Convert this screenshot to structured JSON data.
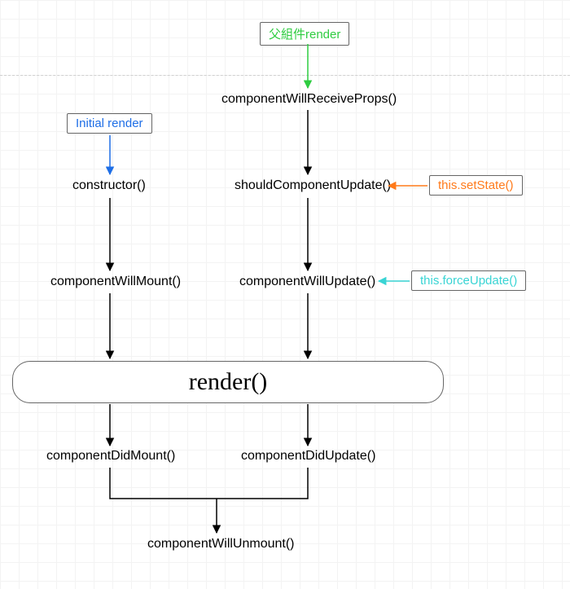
{
  "nodes": {
    "parentRender": "父組件render",
    "initialRender": "Initial render",
    "constructor": "constructor()",
    "componentWillReceiveProps": "componentWillReceiveProps()",
    "shouldComponentUpdate": "shouldComponentUpdate()",
    "setState": "this.setState()",
    "componentWillMount": "componentWillMount()",
    "componentWillUpdate": "componentWillUpdate()",
    "forceUpdate": "this.forceUpdate()",
    "render": "render()",
    "componentDidMount": "componentDidMount()",
    "componentDidUpdate": "componentDidUpdate()",
    "componentWillUnmount": "componentWillUnmount()"
  },
  "colors": {
    "green": "#2ecc40",
    "blue": "#1e6ee6",
    "orange": "#ff7a1a",
    "cyan": "#39d4d4",
    "black": "#000000"
  }
}
